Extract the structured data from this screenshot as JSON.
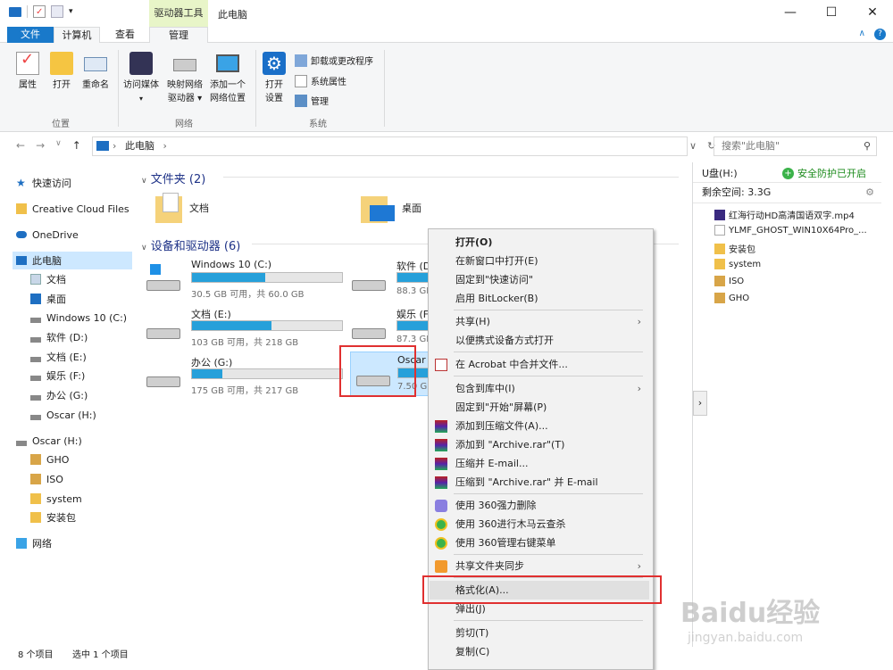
{
  "window": {
    "title": "此电脑",
    "context_tab": "驱动器工具"
  },
  "ribbon_tabs": {
    "file": "文件",
    "computer": "计算机",
    "view": "查看",
    "manage": "管理"
  },
  "ribbon": {
    "location": {
      "label": "位置",
      "properties": "属性",
      "open": "打开",
      "rename": "重命名"
    },
    "network": {
      "label": "网络",
      "media": "访问媒体",
      "map_drive_1": "映射网络",
      "map_drive_2": "驱动器",
      "add_loc_1": "添加一个",
      "add_loc_2": "网络位置"
    },
    "system": {
      "label": "系统",
      "open_settings_1": "打开",
      "open_settings_2": "设置",
      "uninstall": "卸载或更改程序",
      "sys_props": "系统属性",
      "manage": "管理"
    }
  },
  "address": {
    "path": "此电脑",
    "search_placeholder": "搜索\"此电脑\""
  },
  "sidebar": {
    "items": [
      "快速访问",
      "Creative Cloud Files",
      "OneDrive",
      "此电脑",
      "文档",
      "桌面",
      "Windows 10 (C:)",
      "软件 (D:)",
      "文档 (E:)",
      "娱乐 (F:)",
      "办公 (G:)",
      "Oscar (H:)",
      "Oscar (H:)",
      "GHO",
      "ISO",
      "system",
      "安装包",
      "网络"
    ]
  },
  "main": {
    "folders_header": "文件夹 (2)",
    "folders": [
      "文档",
      "桌面"
    ],
    "drives_header": "设备和驱动器 (6)",
    "drives": [
      {
        "name": "Windows 10 (C:)",
        "size": "30.5 GB 可用，共 60.0 GB",
        "used": 0.49
      },
      {
        "name": "软件 (D:)",
        "size": "88.3 GB",
        "used": 0.55
      },
      {
        "name": "文档 (E:)",
        "size": "103 GB 可用，共 218 GB",
        "used": 0.53
      },
      {
        "name": "娱乐 (F:)",
        "size": "87.3 GB",
        "used": 0.6
      },
      {
        "name": "办公 (G:)",
        "size": "175 GB 可用，共 217 GB",
        "used": 0.2
      },
      {
        "name": "Oscar (H:)",
        "size": "7.50 GB",
        "used": 0.55
      }
    ]
  },
  "right_pane": {
    "drive": "U盘(H:)",
    "safe": "安全防护已开启",
    "free": "剩余空间: 3.3G",
    "files": [
      "红海行动HD高清国语双字.mp4",
      "YLMF_GHOST_WIN10X64Pro_...",
      "安装包",
      "system",
      "ISO",
      "GHO"
    ]
  },
  "context_menu": {
    "items": [
      "打开(O)",
      "在新窗口中打开(E)",
      "固定到\"快速访问\"",
      "启用 BitLocker(B)",
      "共享(H)",
      "以便携式设备方式打开",
      "在 Acrobat 中合并文件...",
      "包含到库中(I)",
      "固定到\"开始\"屏幕(P)",
      "添加到压缩文件(A)...",
      "添加到 \"Archive.rar\"(T)",
      "压缩并 E-mail...",
      "压缩到 \"Archive.rar\" 并 E-mail",
      "使用 360强力删除",
      "使用 360进行木马云查杀",
      "使用 360管理右键菜单",
      "共享文件夹同步",
      "格式化(A)...",
      "弹出(J)",
      "剪切(T)",
      "复制(C)"
    ]
  },
  "status": {
    "count": "8 个项目",
    "selected": "选中 1 个项目"
  },
  "watermark": {
    "brand": "Baidu经验",
    "url": "jingyan.baidu.com"
  }
}
